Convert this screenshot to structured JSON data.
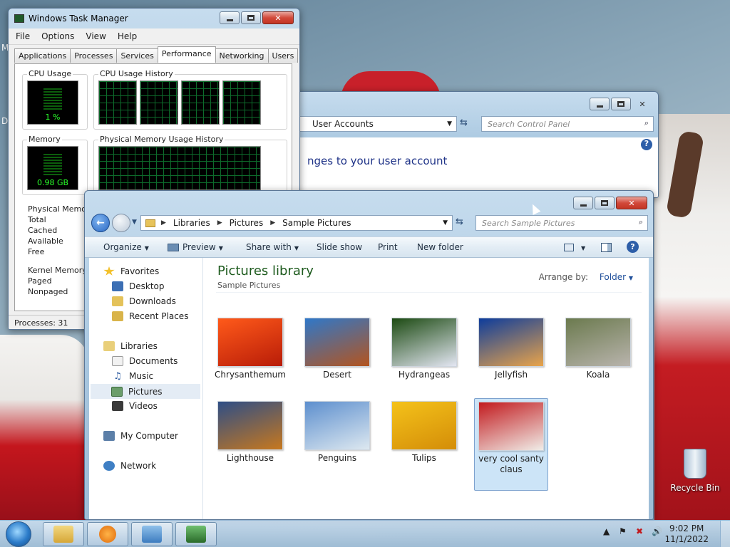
{
  "desktop": {
    "edge_labels": [
      "M",
      "D"
    ],
    "recycle_bin": "Recycle Bin"
  },
  "task_manager": {
    "title": "Windows Task Manager",
    "menu": [
      "File",
      "Options",
      "View",
      "Help"
    ],
    "tabs": [
      "Applications",
      "Processes",
      "Services",
      "Performance",
      "Networking",
      "Users"
    ],
    "active_tab": "Performance",
    "cpu_usage_label": "CPU Usage",
    "cpu_usage_value": "1 %",
    "cpu_history_label": "CPU Usage History",
    "memory_label": "Memory",
    "memory_value": "0.98 GB",
    "memory_history_label": "Physical Memory Usage History",
    "physical_memory": {
      "heading": "Physical Memory",
      "rows": [
        "Total",
        "Cached",
        "Available",
        "Free"
      ]
    },
    "kernel_memory": {
      "heading": "Kernel Memory",
      "rows": [
        "Paged",
        "Nonpaged"
      ]
    },
    "status": "Processes: 31"
  },
  "control_panel": {
    "address": "User Accounts",
    "search_placeholder": "Search Control Panel",
    "heading": "nges to your user account"
  },
  "explorer": {
    "breadcrumb": [
      "Libraries",
      "Pictures",
      "Sample Pictures"
    ],
    "search_placeholder": "Search Sample Pictures",
    "toolbar": {
      "organize": "Organize",
      "preview": "Preview",
      "share_with": "Share with",
      "slide_show": "Slide show",
      "print": "Print",
      "new_folder": "New folder"
    },
    "nav": {
      "favorites": "Favorites",
      "desktop": "Desktop",
      "downloads": "Downloads",
      "recent_places": "Recent Places",
      "libraries": "Libraries",
      "documents": "Documents",
      "music": "Music",
      "pictures": "Pictures",
      "videos": "Videos",
      "my_computer": "My Computer",
      "network": "Network"
    },
    "library_title": "Pictures library",
    "library_subtitle": "Sample Pictures",
    "arrange_by_label": "Arrange by:",
    "arrange_by_value": "Folder",
    "thumbnails": [
      {
        "name": "Chrysanthemum",
        "color1": "#ff5a1a",
        "color2": "#b81c08"
      },
      {
        "name": "Desert",
        "color1": "#2f78c9",
        "color2": "#b4541e"
      },
      {
        "name": "Hydrangeas",
        "color1": "#1c4a12",
        "color2": "#e3e6f2"
      },
      {
        "name": "Jellyfish",
        "color1": "#0d3c9c",
        "color2": "#e9a44a"
      },
      {
        "name": "Koala",
        "color1": "#6b7a4e",
        "color2": "#b9b4ad"
      },
      {
        "name": "Lighthouse",
        "color1": "#2e4e86",
        "color2": "#c7781e"
      },
      {
        "name": "Penguins",
        "color1": "#5d8fce",
        "color2": "#dde8f0"
      },
      {
        "name": "Tulips",
        "color1": "#f4c21a",
        "color2": "#d48d08"
      },
      {
        "name": "very cool santy claus",
        "color1": "#c21a1e",
        "color2": "#f0ede8"
      }
    ]
  },
  "taskbar": {
    "time": "9:02 PM",
    "date": "11/1/2022"
  }
}
